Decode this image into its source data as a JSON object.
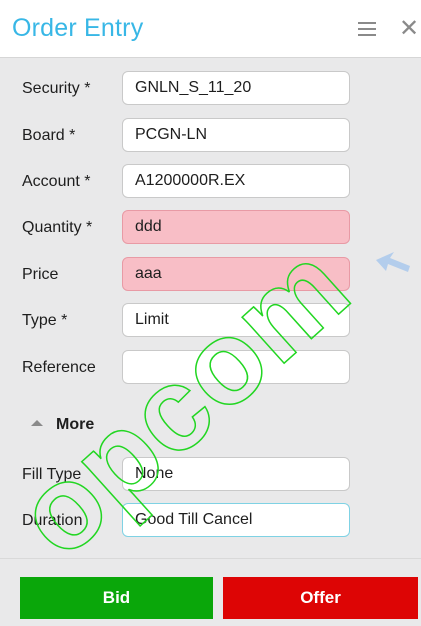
{
  "header": {
    "title": "Order Entry",
    "menu_icon": "hamburger-menu-icon",
    "close_icon": "close-icon",
    "title_color": "#38b7e6"
  },
  "fields": {
    "security": {
      "label": "Security *",
      "value": "GNLN_S_11_20"
    },
    "board": {
      "label": "Board *",
      "value": "PCGN-LN"
    },
    "account": {
      "label": "Account *",
      "value": "A1200000R.EX"
    },
    "quantity": {
      "label": "Quantity *",
      "value": "ddd",
      "state": "error"
    },
    "price": {
      "label": "Price",
      "value": "aaa",
      "state": "error"
    },
    "type": {
      "label": "Type *",
      "value": "Limit"
    },
    "reference": {
      "label": "Reference",
      "value": ""
    }
  },
  "more": {
    "label": "More",
    "icon": "caret-up-icon"
  },
  "more_fields": {
    "fill_type": {
      "label": "Fill Type",
      "value": "None"
    },
    "duration": {
      "label": "Duration",
      "value": "Good Till Cancel",
      "state": "focused"
    }
  },
  "actions": {
    "bid_label": "Bid",
    "offer_label": "Offer",
    "bid_color": "#0aa70a",
    "offer_color": "#dd0505"
  },
  "watermark": {
    "text": "opcom"
  },
  "colors": {
    "error_bg": "#f8bec6",
    "focus_border": "#7fd2e4"
  }
}
